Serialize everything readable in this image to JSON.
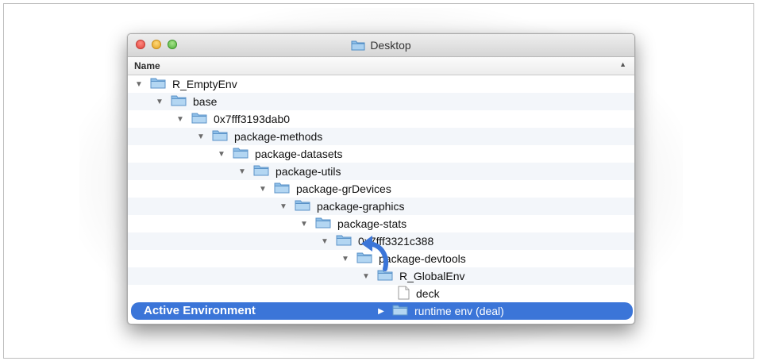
{
  "window": {
    "title": "Desktop",
    "column_header": "Name",
    "sort_indicator": "▲"
  },
  "rows": [
    {
      "label": "R_EmptyEnv",
      "icon": "folder-icon",
      "expanded": true
    },
    {
      "label": "base",
      "icon": "folder-icon",
      "expanded": true
    },
    {
      "label": "0x7fff3193dab0",
      "icon": "folder-icon",
      "expanded": true
    },
    {
      "label": "package-methods",
      "icon": "folder-icon",
      "expanded": true
    },
    {
      "label": "package-datasets",
      "icon": "folder-icon",
      "expanded": true
    },
    {
      "label": "package-utils",
      "icon": "folder-icon",
      "expanded": true
    },
    {
      "label": "package-grDevices",
      "icon": "folder-icon",
      "expanded": true
    },
    {
      "label": "package-graphics",
      "icon": "folder-icon",
      "expanded": true
    },
    {
      "label": "package-stats",
      "icon": "folder-icon",
      "expanded": true
    },
    {
      "label": "0x7fff3321c388",
      "icon": "folder-icon",
      "expanded": true
    },
    {
      "label": "package-devtools",
      "icon": "folder-icon",
      "expanded": true
    },
    {
      "label": "R_GlobalEnv",
      "icon": "folder-icon",
      "expanded": true
    },
    {
      "label": "deck",
      "icon": "file-icon",
      "expanded": false
    },
    {
      "label": "runtime env (deal)",
      "icon": "folder-icon",
      "expanded": false,
      "selected": true
    }
  ],
  "annotation": {
    "active_label": "Active Environment",
    "arrow_icon": "curved-arrow-icon",
    "accent_color": "#3b75d8"
  },
  "icons": {
    "expanded": "▼",
    "collapsed": "▶"
  }
}
